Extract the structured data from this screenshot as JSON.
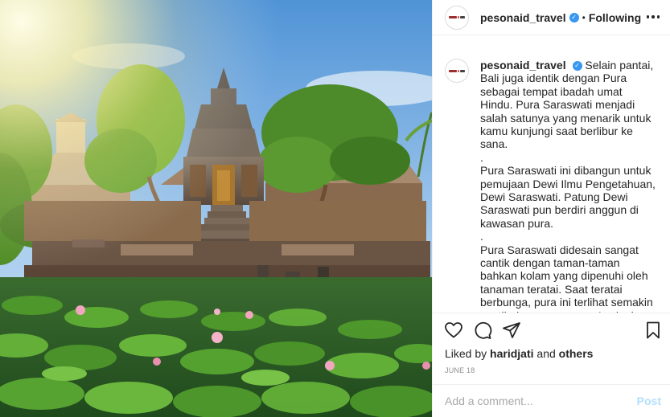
{
  "post": {
    "image_subject": "Pura Saraswati temple with lotus pond"
  },
  "header": {
    "username": "pesonaid_travel",
    "separator": "•",
    "follow_status": "Following",
    "verified_mark": "✓"
  },
  "caption": {
    "username": "pesonaid_travel",
    "paragraph_1": "Selain pantai, Bali juga identik dengan Pura sebagai tempat ibadah umat Hindu. Pura Saraswati menjadi salah satunya yang menarik untuk kamu kunjungi saat berlibur ke sana.",
    "dot_1": ".",
    "paragraph_2": "Pura Saraswati ini dibangun untuk pemujaan Dewi Ilmu Pengetahuan, Dewi Saraswati. Patung Dewi Saraswati pun berdiri anggun di kawasan pura.",
    "dot_2": ".",
    "paragraph_3": "Pura Saraswati didesain sangat cantik dengan taman-taman bahkan kolam yang dipenuhi oleh tanaman teratai. Saat teratai berbunga, pura ini terlihat semakin cantik dan memesona. Apalagi ornamen seni ukir yang sangat artistik menambah"
  },
  "actions": {
    "icons": [
      "heart-icon",
      "comment-icon",
      "share-icon",
      "bookmark-icon"
    ]
  },
  "likes": {
    "prefix": "Liked by",
    "user": "haridjati",
    "joiner": "and",
    "others": "others"
  },
  "date": "JUNE 18",
  "add_comment": {
    "placeholder": "Add a comment...",
    "post_label": "Post"
  },
  "colors": {
    "verified": "#3897f0",
    "text": "#262626",
    "muted": "#8e8e8e",
    "post_disabled": "#b2dffc",
    "border": "#efefef"
  }
}
